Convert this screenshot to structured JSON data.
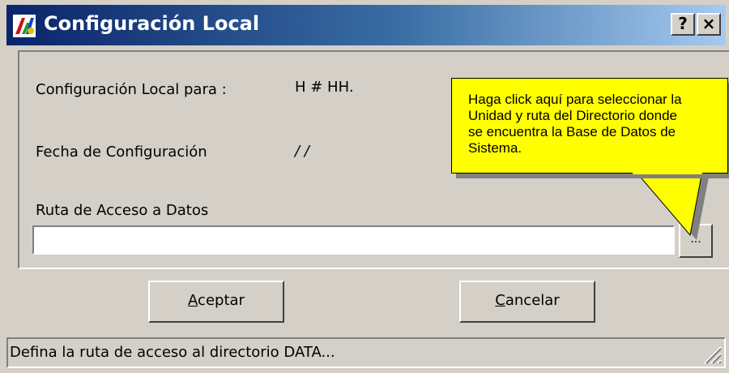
{
  "window": {
    "title": "Configuración Local",
    "help_button": "?",
    "close_button": "×"
  },
  "form": {
    "config_label": "Configuración Local para :",
    "config_value": "H # HH.",
    "date_label": "Fecha de Configuración",
    "date_value": "/ /",
    "path_label": "Ruta de Acceso a Datos",
    "path_value": "",
    "browse_label": "..."
  },
  "tooltip": {
    "lines": [
      "Haga click aquí para seleccionar la",
      "Unidad y ruta del Directorio donde",
      "se encuentra  la Base de Datos de",
      "Sistema."
    ]
  },
  "buttons": {
    "accept_mnemonic": "A",
    "accept_rest": "ceptar",
    "cancel_mnemonic": "C",
    "cancel_rest": "ancelar"
  },
  "status": {
    "text": "Defina la ruta de acceso al directorio DATA..."
  },
  "colors": {
    "tooltip_bg": "#ffff00",
    "titlebar_start": "#0a246a",
    "titlebar_end": "#a6caf0",
    "window_bg": "#d4d0c8"
  },
  "icons": {
    "app": "multicolor-app-icon",
    "browse": "ellipsis-icon",
    "grip": "resize-grip-icon"
  }
}
